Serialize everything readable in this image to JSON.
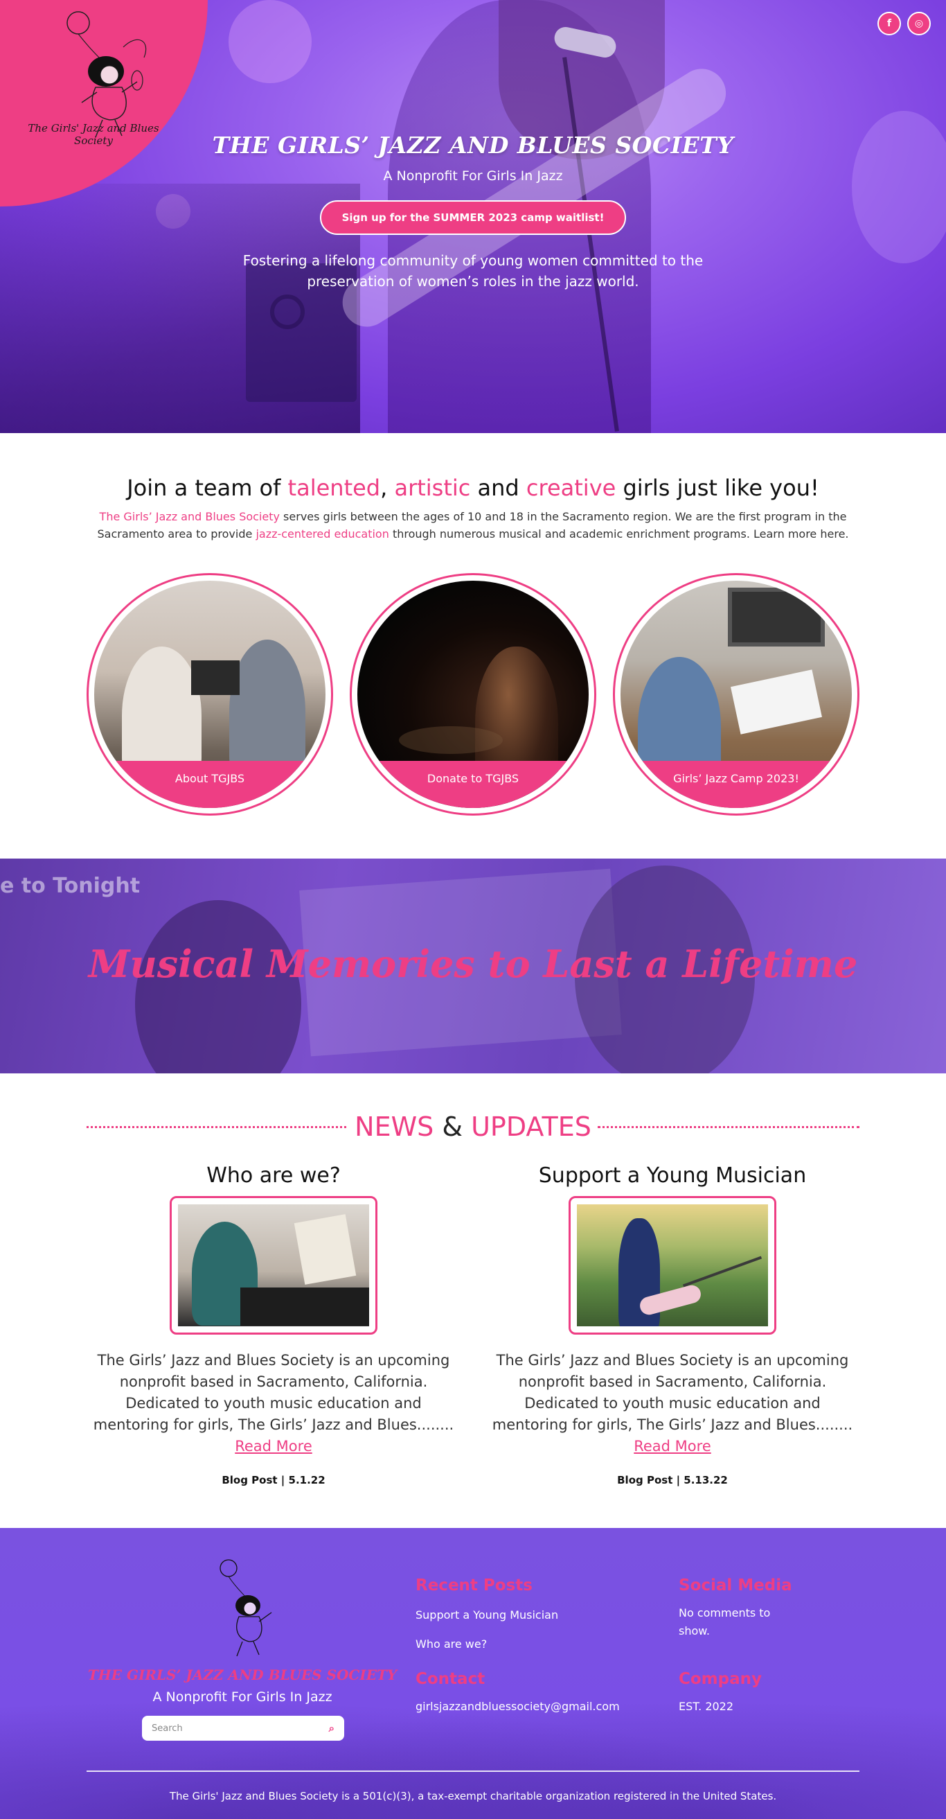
{
  "hero": {
    "logo_text": "The Girls' Jazz and Blues Society",
    "title": "THE GIRLS’ JAZZ AND BLUES SOCIETY",
    "subtitle": "A Nonprofit For Girls In Jazz",
    "cta": "Sign up for the SUMMER 2023 camp waitlist!",
    "description": "Fostering a lifelong community of young women committed to the preservation of women’s roles in the jazz world.",
    "social": [
      {
        "icon": "facebook-icon",
        "glyph": "f"
      },
      {
        "icon": "instagram-icon",
        "glyph": "◎"
      }
    ]
  },
  "intro": {
    "heading_parts": [
      "Join a team of ",
      "talented",
      ", ",
      "artistic",
      " and ",
      "creative",
      " girls just like you!"
    ],
    "p1_link": "The Girls’ Jazz and Blues Society",
    "p1_text": " serves girls between the ages of 10 and 18 in the Sacramento region. We are the first program in the Sacramento area to provide ",
    "p1_link2": "jazz-centered education",
    "p1_text2": " through numerous musical and academic enrichment programs. Learn more here."
  },
  "circles": [
    {
      "label": "About TGJBS"
    },
    {
      "label": "Donate to TGJBS"
    },
    {
      "label": "Girls’ Jazz Camp 2023!"
    }
  ],
  "banner": {
    "heading": "Musical Memories to Last a Lifetime",
    "bg_sign": "e to Tonight"
  },
  "news": {
    "heading_a": "NEWS",
    "heading_amp": " & ",
    "heading_b": "UPDATES",
    "posts": [
      {
        "title": "Who are we?",
        "excerpt": "The Girls’ Jazz and Blues Society is an upcoming nonprofit based in Sacramento, California. Dedicated to youth music education and mentoring for girls, The Girls’ Jazz and Blues........ ",
        "read_more": "Read More",
        "meta": "Blog Post | 5.1.22"
      },
      {
        "title": "Support a Young Musician",
        "excerpt": "The Girls’ Jazz and Blues Society is an upcoming nonprofit based in Sacramento, California. Dedicated to youth music education and mentoring for girls, The Girls’ Jazz and Blues........ ",
        "read_more": "Read More",
        "meta": "Blog Post | 5.13.22"
      }
    ]
  },
  "footer": {
    "title": "THE GIRLS’ JAZZ AND BLUES SOCIETY",
    "subtitle": "A Nonprofit For Girls In Jazz",
    "search_placeholder": "Search",
    "recent_heading": "Recent Posts",
    "recent_links": [
      "Support a Young Musician",
      "Who are we?"
    ],
    "social_heading": "Social Media",
    "social_text": "No comments to show.",
    "contact_heading": "Contact",
    "contact_email": "girlsjazzandbluessociety@gmail.com",
    "company_heading": "Company",
    "company_text": "EST. 2022",
    "legal": "The Girls' Jazz and Blues Society is a 501(c)(3), a tax-exempt charitable organization registered in the United States."
  },
  "colors": {
    "accent": "#ee3e84",
    "purple": "#7b4fe6"
  }
}
